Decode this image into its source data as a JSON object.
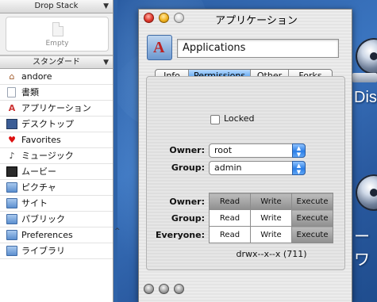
{
  "sidebar": {
    "drop_stack": {
      "title": "Drop Stack",
      "empty_label": "Empty"
    },
    "standard": {
      "title": "スタンダード",
      "items": [
        {
          "label": "andore",
          "icon": "home-icon"
        },
        {
          "label": "書類",
          "icon": "document-icon"
        },
        {
          "label": "アプリケーション",
          "icon": "applications-icon"
        },
        {
          "label": "デスクトップ",
          "icon": "desktop-icon"
        },
        {
          "label": "Favorites",
          "icon": "heart-icon"
        },
        {
          "label": "ミュージック",
          "icon": "music-icon"
        },
        {
          "label": "ムービー",
          "icon": "movie-icon"
        },
        {
          "label": "ピクチャ",
          "icon": "pictures-folder-icon"
        },
        {
          "label": "サイト",
          "icon": "sites-folder-icon"
        },
        {
          "label": "パブリック",
          "icon": "public-folder-icon"
        },
        {
          "label": "Preferences",
          "icon": "folder-icon"
        },
        {
          "label": "ライブラリ",
          "icon": "library-folder-icon"
        }
      ]
    }
  },
  "window": {
    "title": "アプリケーション",
    "name_field": "Applications",
    "tabs": [
      {
        "label": "Info",
        "selected": false
      },
      {
        "label": "Permissions",
        "selected": true
      },
      {
        "label": "Other",
        "selected": false
      },
      {
        "label": "Forks",
        "selected": false
      }
    ],
    "locked": {
      "label": "Locked",
      "checked": false
    },
    "owner": {
      "label": "Owner:",
      "value": "root"
    },
    "group": {
      "label": "Group:",
      "value": "admin"
    },
    "permissions": {
      "rows": [
        {
          "label": "Owner:",
          "read": "Read",
          "write": "Write",
          "execute": "Execute",
          "read_on": true,
          "write_on": true,
          "execute_on": true
        },
        {
          "label": "Group:",
          "read": "Read",
          "write": "Write",
          "execute": "Execute",
          "read_on": false,
          "write_on": false,
          "execute_on": true
        },
        {
          "label": "Everyone:",
          "read": "Read",
          "write": "Write",
          "execute": "Execute",
          "read_on": false,
          "write_on": false,
          "execute_on": true
        }
      ],
      "summary": "drwx--x--x (711)"
    }
  },
  "desktop": {
    "disk_labels": [
      "Disk",
      "ーワ"
    ]
  },
  "colors": {
    "selected_tab": "#5ea6f1",
    "desktop_blue": "#2f63a8",
    "close": "#e0392e",
    "minimize": "#f1b21e"
  }
}
